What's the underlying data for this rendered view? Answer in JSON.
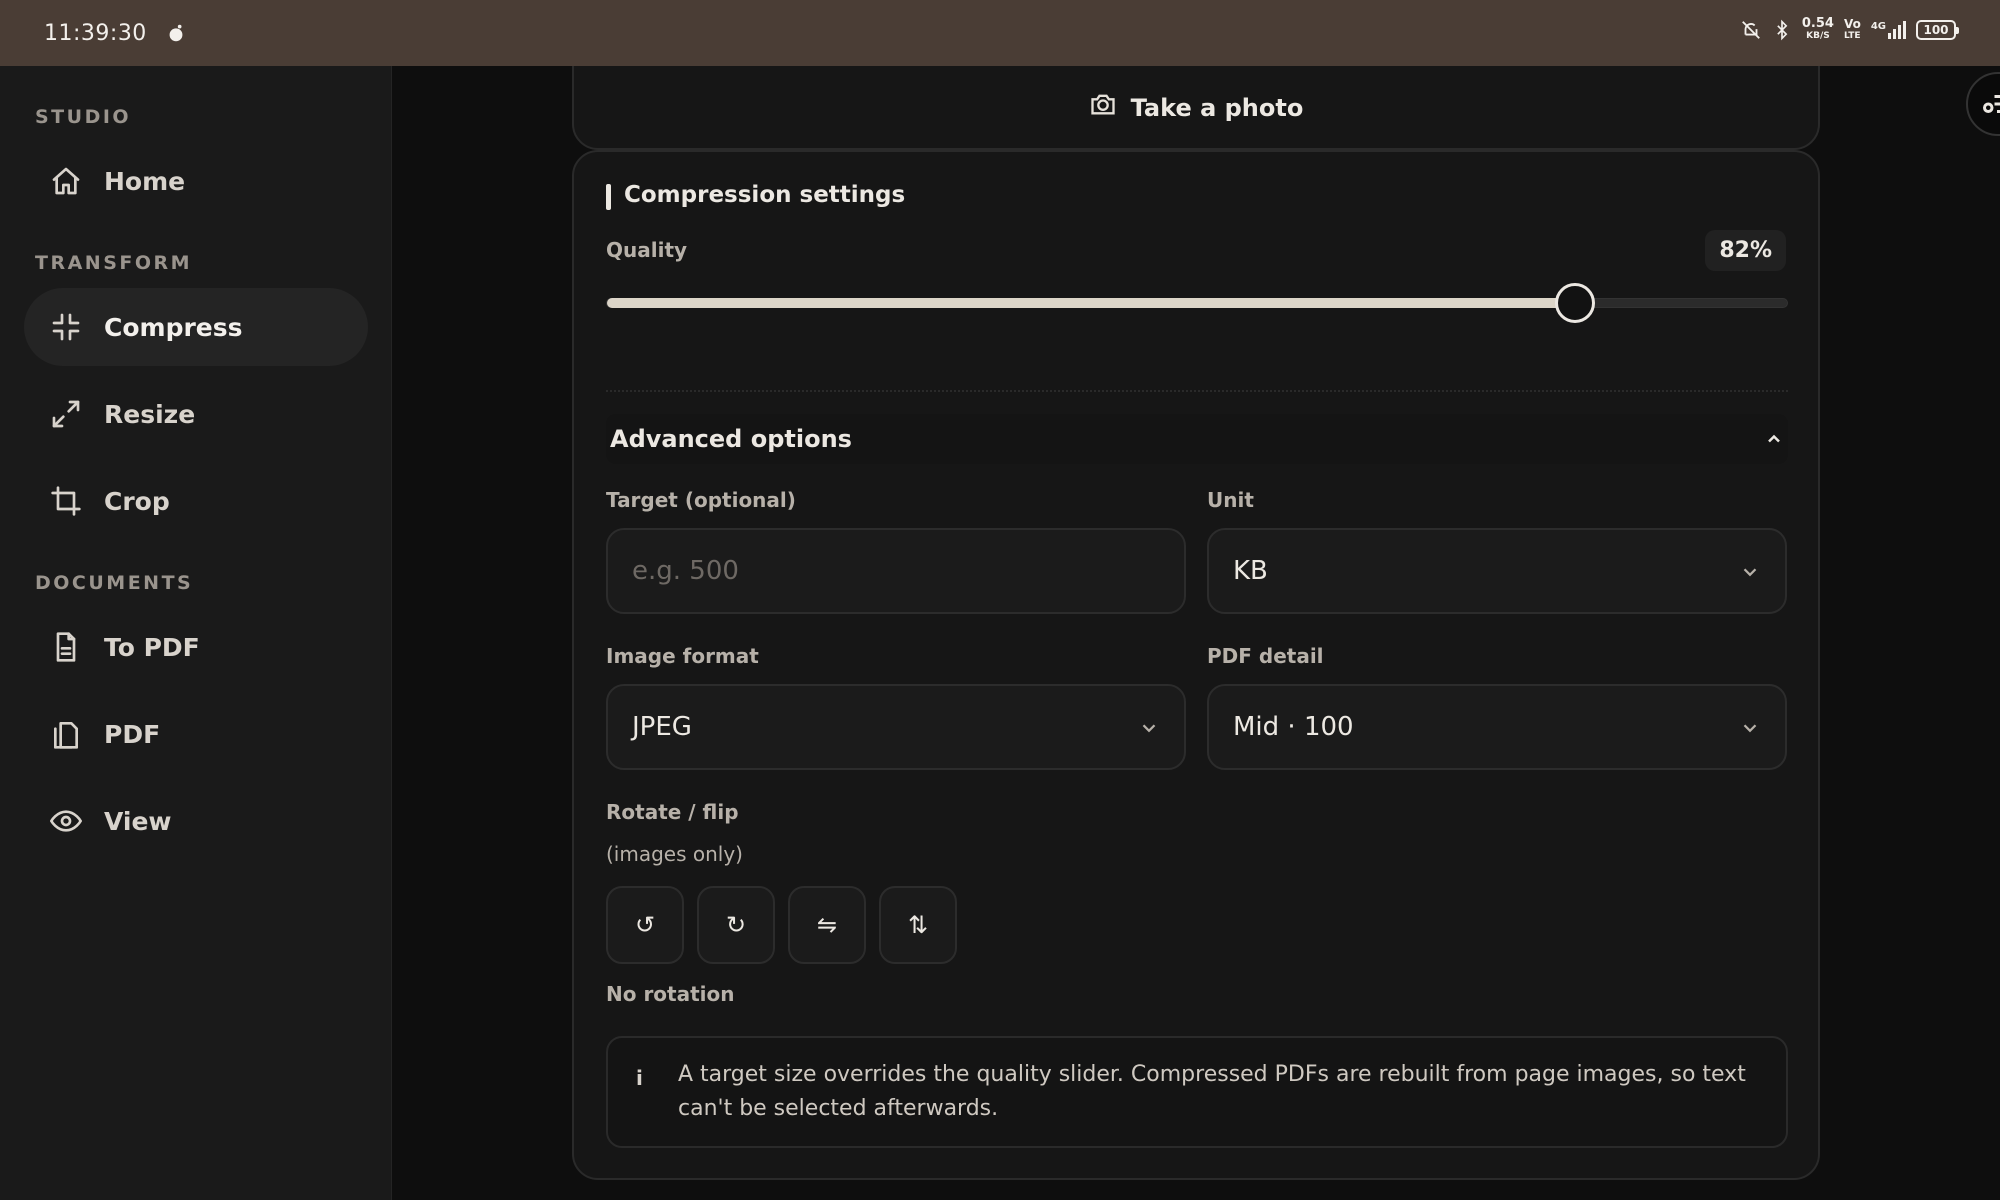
{
  "status_bar": {
    "time": "11:39:30",
    "speed_top": "0.54",
    "speed_bottom": "KB/S",
    "net_top": "Vo",
    "net_bottom": "LTE",
    "signal": "4G",
    "battery": "100"
  },
  "sidebar": {
    "sections": [
      {
        "label": "STUDIO"
      },
      {
        "label": "TRANSFORM"
      },
      {
        "label": "DOCUMENTS"
      }
    ],
    "items": [
      {
        "label": "Home",
        "icon": "home-icon"
      },
      {
        "label": "Compress",
        "icon": "compress-icon",
        "active": true
      },
      {
        "label": "Resize",
        "icon": "resize-icon"
      },
      {
        "label": "Crop",
        "icon": "crop-icon"
      },
      {
        "label": "To PDF",
        "icon": "file-icon"
      },
      {
        "label": "PDF",
        "icon": "files-icon"
      },
      {
        "label": "View",
        "icon": "eye-icon"
      }
    ]
  },
  "main": {
    "take_photo": "Take a photo",
    "compression": {
      "title": "Compression settings",
      "quality_label": "Quality",
      "quality_value": "82%",
      "quality_fraction": 0.82,
      "advanced_label": "Advanced options",
      "target_label": "Target (optional)",
      "target_placeholder": "e.g. 500",
      "unit_label": "Unit",
      "unit_value": "KB",
      "format_label": "Image format",
      "format_value": "JPEG",
      "pdf_label": "PDF detail",
      "pdf_value": "Mid · 100",
      "rotate_label": "Rotate / flip",
      "rotate_sub": "(images only)",
      "rotate_buttons": [
        {
          "glyph": "↺",
          "icon": "rotate-left-icon"
        },
        {
          "glyph": "↻",
          "icon": "rotate-right-icon"
        },
        {
          "glyph": "⇋",
          "icon": "flip-horizontal-icon"
        },
        {
          "glyph": "⇅",
          "icon": "flip-vertical-icon"
        }
      ],
      "rotation_status": "No rotation",
      "info_icon": "i",
      "info_text": "A target size overrides the quality slider. Compressed PDFs are rebuilt from page images, so text can't be selected afterwards."
    }
  }
}
